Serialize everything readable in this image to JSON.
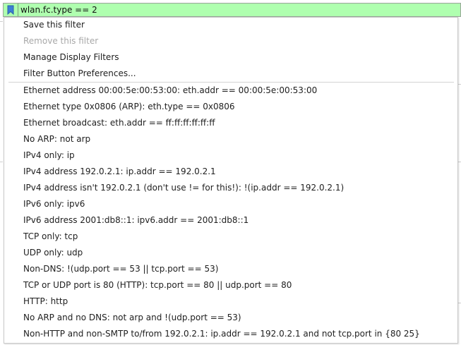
{
  "filter": {
    "value": "wlan.fc.type == 2",
    "background_color": "#afffaf"
  },
  "menu": {
    "actions": [
      {
        "label": "Save this filter",
        "enabled": true
      },
      {
        "label": "Remove this filter",
        "enabled": false
      },
      {
        "label": "Manage Display Filters",
        "enabled": true
      },
      {
        "label": "Filter Button Preferences...",
        "enabled": true
      }
    ],
    "saved_filters": [
      "Ethernet address 00:00:5e:00:53:00: eth.addr == 00:00:5e:00:53:00",
      "Ethernet type 0x0806 (ARP): eth.type == 0x0806",
      "Ethernet broadcast: eth.addr == ff:ff:ff:ff:ff:ff",
      "No ARP: not arp",
      "IPv4 only: ip",
      "IPv4 address 192.0.2.1: ip.addr == 192.0.2.1",
      "IPv4 address isn't 192.0.2.1 (don't use != for this!): !(ip.addr == 192.0.2.1)",
      "IPv6 only: ipv6",
      "IPv6 address 2001:db8::1: ipv6.addr == 2001:db8::1",
      "TCP only: tcp",
      "UDP only: udp",
      "Non-DNS: !(udp.port == 53 || tcp.port == 53)",
      "TCP or UDP port is 80 (HTTP): tcp.port == 80 || udp.port == 80",
      "HTTP: http",
      "No ARP and no DNS: not arp and !(udp.port == 53)",
      "Non-HTTP and non-SMTP to/from 192.0.2.1: ip.addr == 192.0.2.1 and not tcp.port in {80 25}"
    ]
  }
}
